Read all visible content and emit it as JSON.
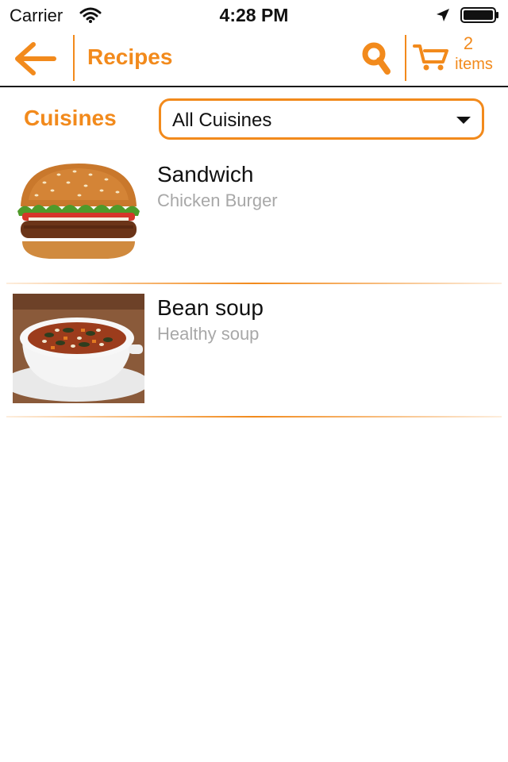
{
  "status_bar": {
    "carrier": "Carrier",
    "time": "4:28 PM",
    "icons": [
      "wifi-icon",
      "location-arrow-icon",
      "battery-icon"
    ]
  },
  "nav": {
    "back_icon": "arrow-left-icon",
    "title": "Recipes",
    "search_icon": "search-icon",
    "cart_icon": "cart-icon",
    "cart_count": "2",
    "cart_label": "items"
  },
  "filter": {
    "label": "Cuisines",
    "selected": "All Cuisines",
    "caret_icon": "caret-down-icon"
  },
  "recipes": [
    {
      "title": "Sandwich",
      "subtitle": "Chicken Burger",
      "image": "burger-photo"
    },
    {
      "title": "Bean soup",
      "subtitle": "Healthy soup",
      "image": "bean-soup-photo"
    }
  ],
  "colors": {
    "accent": "#f28a1c",
    "text": "#111111",
    "subtitle": "#a8a8a8",
    "background": "#ffffff"
  }
}
